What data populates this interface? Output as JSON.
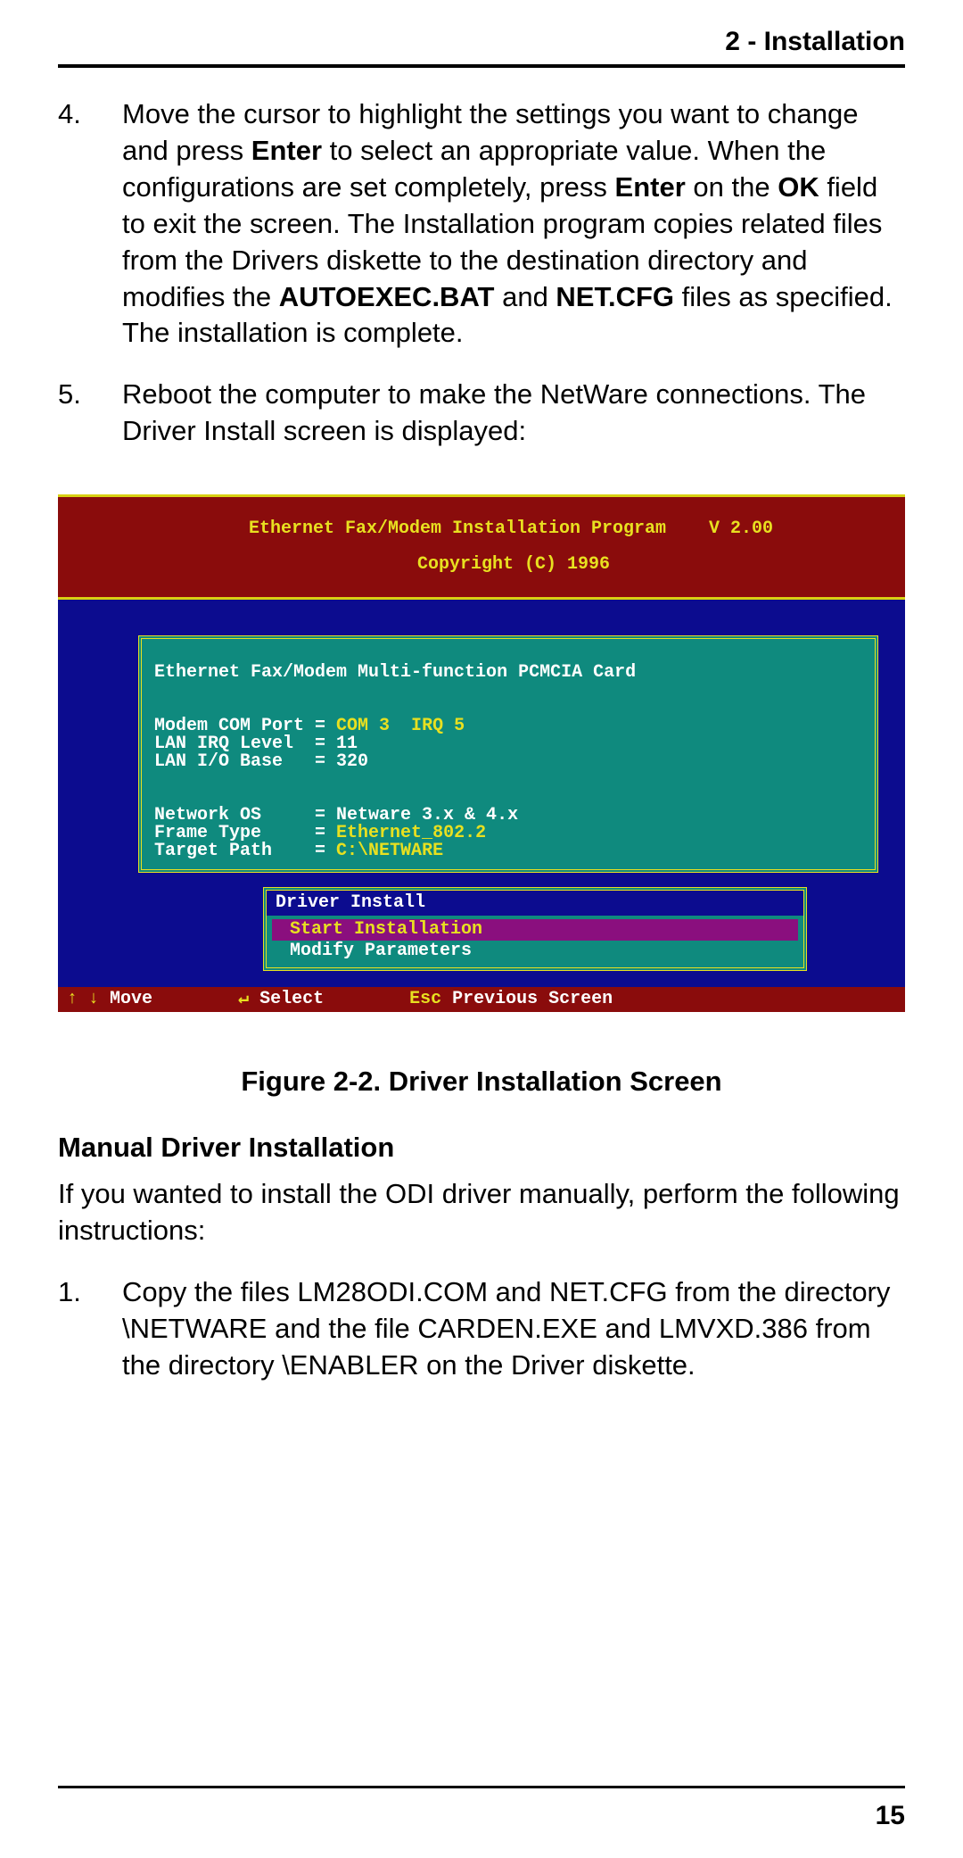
{
  "header": {
    "section": "2 - Installation"
  },
  "steps_a": [
    {
      "num": "4.",
      "segments": [
        {
          "t": "Move the cursor to highlight the settings you want to change and press "
        },
        {
          "t": "Enter",
          "b": true
        },
        {
          "t": " to select an appropriate   value. When the configurations are set completely,   press "
        },
        {
          "t": "Enter",
          "b": true
        },
        {
          "t": " on the "
        },
        {
          "t": "OK",
          "b": true
        },
        {
          "t": " field to exit the screen.  The Installation program copies related files from the Drivers diskette to the destination directory and modifies the "
        },
        {
          "t": "AUTOEXEC.BAT",
          "b": true
        },
        {
          "t": " and "
        },
        {
          "t": "NET.CFG",
          "b": true
        },
        {
          "t": " files as specified.  The installation is complete."
        }
      ]
    },
    {
      "num": "5.",
      "segments": [
        {
          "t": "Reboot the computer to make the NetWare connections.  The Driver Install screen is displayed:"
        }
      ]
    }
  ],
  "dos": {
    "title_line1": "Ethernet Fax/Modem Installation Program",
    "title_line2": "Copyright (C) 1996",
    "version": "V 2.00",
    "card_header": "Ethernet Fax/Modem Multi-function PCMCIA Card",
    "rows": [
      {
        "label": "Modem COM Port ",
        "eq": "= ",
        "val": "COM 3  IRQ 5",
        "yl": true
      },
      {
        "label": "LAN IRQ Level  ",
        "eq": "= ",
        "val": "11",
        "yl": false
      },
      {
        "label": "LAN I/O Base   ",
        "eq": "= ",
        "val": "320",
        "yl": false
      }
    ],
    "rows2": [
      {
        "label": "Network OS     ",
        "eq": "= ",
        "val": "Netware 3.x & 4.x",
        "yl": false
      },
      {
        "label": "Frame Type     ",
        "eq": "= ",
        "val": "Ethernet_802.2",
        "yl": true
      },
      {
        "label": "Target Path    ",
        "eq": "= ",
        "val": "C:\\NETWARE",
        "yl": true
      }
    ],
    "driver_title": "Driver Install",
    "menu": [
      {
        "label": "Start Installation",
        "selected": true
      },
      {
        "label": "Modify Parameters",
        "selected": false
      }
    ],
    "footer": {
      "move_sym": "↑ ↓ ",
      "move": "Move",
      "sel_sym": "↵ ",
      "sel": "Select",
      "esc": "Esc ",
      "prev": "Previous Screen"
    }
  },
  "figure_caption": "Figure 2-2. Driver Installation Screen",
  "subheading": "Manual Driver Installation",
  "sub_para": "If you wanted to install the ODI driver manually, perform the following instructions:",
  "steps_b": [
    {
      "num": "1.",
      "segments": [
        {
          "t": "Copy the files LM28ODI.COM and NET.CFG from the directory \\NETWARE and the file CARDEN.EXE and LMVXD.386 from the directory \\ENABLER on the Driver diskette."
        }
      ]
    }
  ],
  "page_number": "15"
}
